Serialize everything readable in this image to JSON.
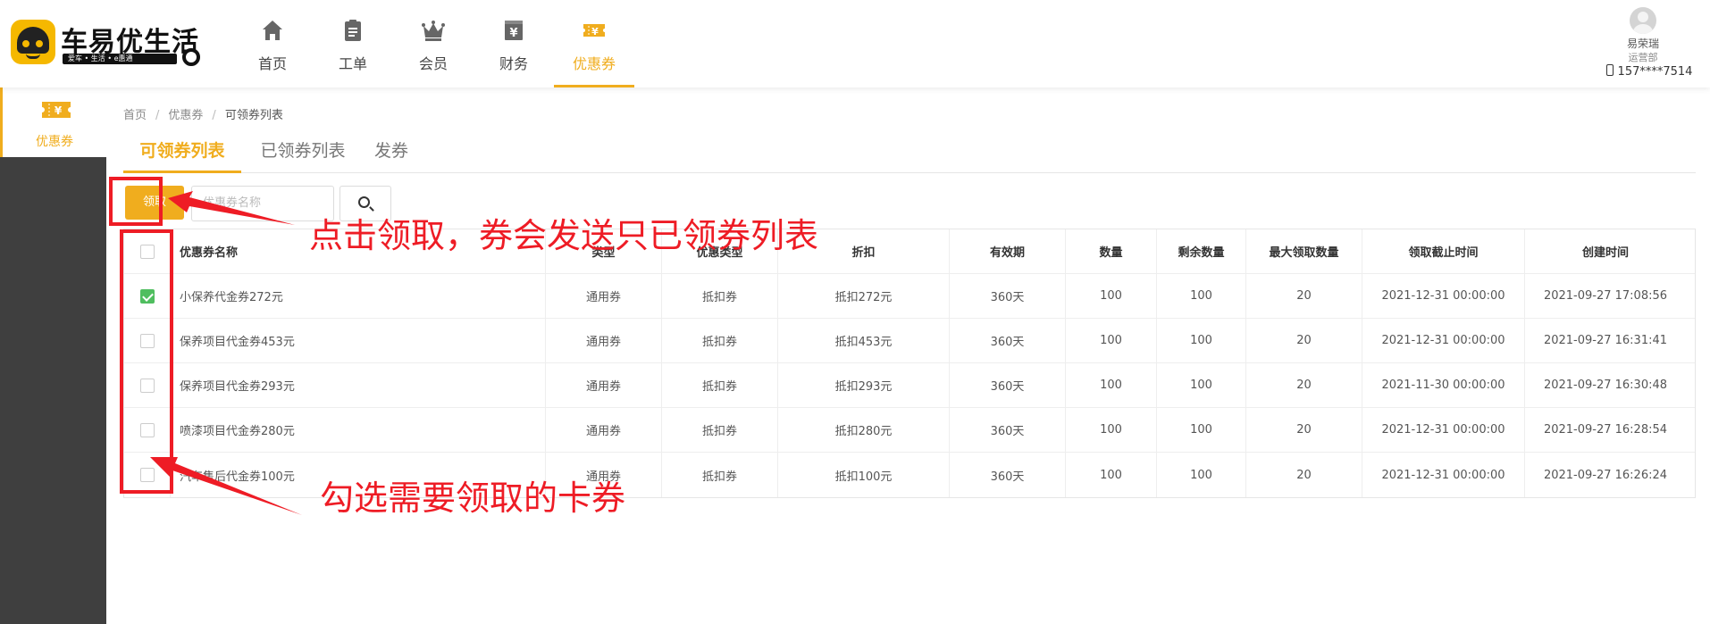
{
  "app": {
    "logo_text": "车易优生活",
    "logo_slogan": "爱车 • 生活 • e惠通"
  },
  "nav": [
    {
      "label": "首页",
      "icon": "home-icon"
    },
    {
      "label": "工单",
      "icon": "clipboard-icon"
    },
    {
      "label": "会员",
      "icon": "crown-icon"
    },
    {
      "label": "财务",
      "icon": "finance-icon"
    },
    {
      "label": "优惠券",
      "icon": "coupon-icon",
      "active": true
    }
  ],
  "user": {
    "name": "易荣瑞",
    "dept": "运营部",
    "phone": "157****7514"
  },
  "sidebar": {
    "items": [
      {
        "label": "优惠券",
        "icon": "coupon-icon",
        "active": true
      }
    ]
  },
  "breadcrumb": {
    "home": "首页",
    "section": "优惠券",
    "current": "可领券列表"
  },
  "tabs": [
    {
      "label": "可领券列表",
      "active": true
    },
    {
      "label": "已领券列表"
    },
    {
      "label": "发券"
    }
  ],
  "toolbar": {
    "receive_label": "领取",
    "search_placeholder": "优惠券名称"
  },
  "table": {
    "headers": [
      "优惠券名称",
      "类型",
      "优惠类型",
      "折扣",
      "有效期",
      "数量",
      "剩余数量",
      "最大领取数量",
      "领取截止时间",
      "创建时间"
    ],
    "rows": [
      {
        "checked": true,
        "cells": [
          "小保养代金券272元",
          "通用券",
          "抵扣券",
          "抵扣272元",
          "360天",
          "100",
          "100",
          "20",
          "2021-12-31 00:00:00",
          "2021-09-27 17:08:56"
        ]
      },
      {
        "checked": false,
        "cells": [
          "保养项目代金券453元",
          "通用券",
          "抵扣券",
          "抵扣453元",
          "360天",
          "100",
          "100",
          "20",
          "2021-12-31 00:00:00",
          "2021-09-27 16:31:41"
        ]
      },
      {
        "checked": false,
        "cells": [
          "保养项目代金券293元",
          "通用券",
          "抵扣券",
          "抵扣293元",
          "360天",
          "100",
          "100",
          "20",
          "2021-11-30 00:00:00",
          "2021-09-27 16:30:48"
        ]
      },
      {
        "checked": false,
        "cells": [
          "喷漆项目代金券280元",
          "通用券",
          "抵扣券",
          "抵扣280元",
          "360天",
          "100",
          "100",
          "20",
          "2021-12-31 00:00:00",
          "2021-09-27 16:28:54"
        ]
      },
      {
        "checked": false,
        "cells": [
          "汽车售后代金券100元",
          "通用券",
          "抵扣券",
          "抵扣100元",
          "360天",
          "100",
          "100",
          "20",
          "2021-12-31 00:00:00",
          "2021-09-27 16:26:24"
        ]
      }
    ]
  },
  "annotations": {
    "receive_note": "点击领取，券会发送只已领券列表",
    "select_note": "勾选需要领取的卡券",
    "color": "#ee1c25"
  },
  "colors": {
    "accent": "#f0ad1e",
    "sidebar_bg": "#3f3f3f",
    "checkbox_on": "#4fbe5f"
  }
}
